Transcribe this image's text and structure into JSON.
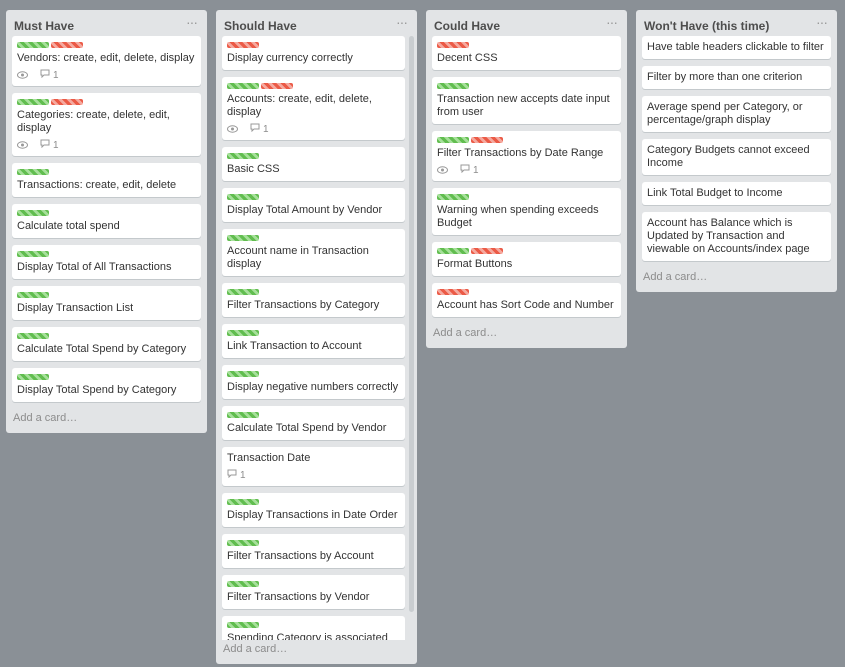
{
  "lists": [
    {
      "title": "Must Have",
      "menu": "···",
      "add_card": "Add a card…",
      "cards": [
        {
          "text": "Vendors: create, edit, delete, display",
          "labels": [
            "green",
            "red"
          ],
          "comments": "1",
          "watched": true
        },
        {
          "text": "Categories: create, delete, edit, display",
          "labels": [
            "green",
            "red"
          ],
          "comments": "1",
          "watched": true
        },
        {
          "text": "Transactions: create, edit, delete",
          "labels": [
            "green"
          ]
        },
        {
          "text": "Calculate total spend",
          "labels": [
            "green"
          ]
        },
        {
          "text": "Display Total of All Transactions",
          "labels": [
            "green"
          ]
        },
        {
          "text": "Display Transaction List",
          "labels": [
            "green"
          ]
        },
        {
          "text": "Calculate Total Spend by Category",
          "labels": [
            "green"
          ]
        },
        {
          "text": "Display Total Spend by Category",
          "labels": [
            "green"
          ]
        }
      ]
    },
    {
      "title": "Should Have",
      "menu": "···",
      "add_card": "Add a card…",
      "cards": [
        {
          "text": "Display currency correctly",
          "labels": [
            "red"
          ]
        },
        {
          "text": "Accounts: create, edit, delete, display",
          "labels": [
            "green",
            "red"
          ],
          "comments": "1",
          "watched": true
        },
        {
          "text": "Basic CSS",
          "labels": [
            "green"
          ]
        },
        {
          "text": "Display Total Amount by Vendor",
          "labels": [
            "green"
          ]
        },
        {
          "text": "Account name in Transaction display",
          "labels": [
            "green"
          ]
        },
        {
          "text": "Filter Transactions by Category",
          "labels": [
            "green"
          ]
        },
        {
          "text": "Link Transaction to Account",
          "labels": [
            "green"
          ]
        },
        {
          "text": "Display negative numbers correctly",
          "labels": [
            "green"
          ]
        },
        {
          "text": "Calculate Total Spend by Vendor",
          "labels": [
            "green"
          ]
        },
        {
          "text": "Transaction Date",
          "labels": [],
          "comments": "1"
        },
        {
          "text": "Display Transactions in Date Order",
          "labels": [
            "green"
          ]
        },
        {
          "text": "Filter Transactions by Account",
          "labels": [
            "green"
          ]
        },
        {
          "text": "Filter Transactions by Vendor",
          "labels": [
            "green"
          ]
        },
        {
          "text": "Spending Category is associated",
          "labels": [
            "green"
          ]
        }
      ]
    },
    {
      "title": "Could Have",
      "menu": "···",
      "add_card": "Add a card…",
      "cards": [
        {
          "text": "Decent CSS",
          "labels": [
            "red"
          ]
        },
        {
          "text": "Transaction new accepts date input from user",
          "labels": [
            "green"
          ]
        },
        {
          "text": "Filter Transactions by Date Range",
          "labels": [
            "green",
            "red"
          ],
          "comments": "1",
          "watched": true
        },
        {
          "text": "Warning when spending exceeds Budget",
          "labels": [
            "green"
          ]
        },
        {
          "text": "Format Buttons",
          "labels": [
            "green",
            "red"
          ]
        },
        {
          "text": "Account has Sort Code and Number",
          "labels": [
            "red"
          ]
        }
      ]
    },
    {
      "title": "Won't Have (this time)",
      "menu": "···",
      "add_card": "Add a card…",
      "cards": [
        {
          "text": "Have table headers clickable to filter",
          "labels": []
        },
        {
          "text": "Filter by more than one criterion",
          "labels": []
        },
        {
          "text": "Average spend per Category, or percentage/graph display",
          "labels": []
        },
        {
          "text": "Category Budgets cannot exceed Income",
          "labels": []
        },
        {
          "text": "Link Total Budget to Income",
          "labels": []
        },
        {
          "text": "Account has Balance which is Updated by Transaction and viewable on Accounts/index page",
          "labels": []
        }
      ]
    }
  ],
  "colors": {
    "label_green": "#61bd4f",
    "label_red": "#eb5a46",
    "board_bg": "#8a9096",
    "list_bg": "#e2e4e6"
  },
  "icons": {
    "watch": "eye-icon",
    "comment": "comment-icon"
  }
}
